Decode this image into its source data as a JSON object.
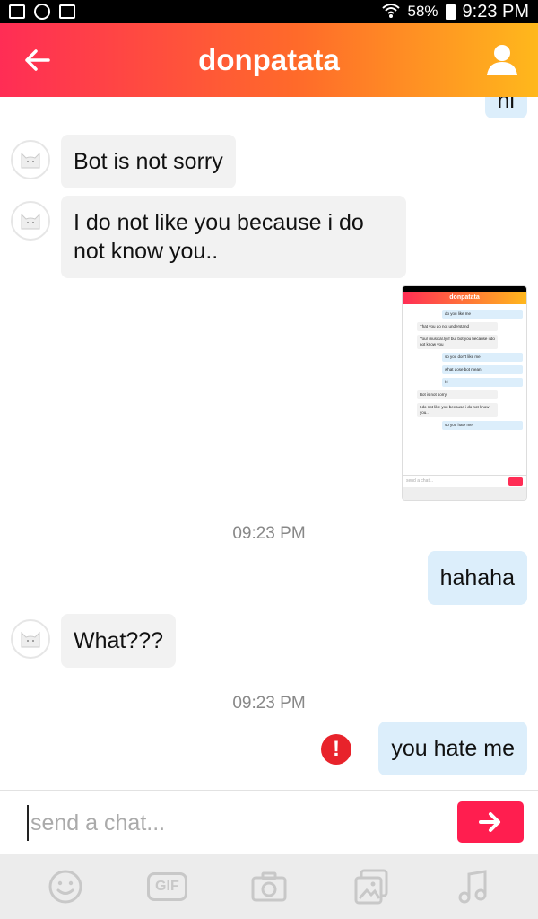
{
  "status_bar": {
    "battery": "58%",
    "time": "9:23 PM"
  },
  "header": {
    "title": "donpatata"
  },
  "messages": {
    "partial_out": "hi",
    "msg1": "Bot is not sorry",
    "msg2_line1": "I do not like you because i do",
    "msg2_line2": "not know you..",
    "time1": "09:23 PM",
    "msg3": "hahaha",
    "msg4": "What???",
    "time2": "09:23 PM",
    "msg5": "you hate me"
  },
  "thumbnail": {
    "title": "donpatata",
    "lines": [
      "do you like me",
      "That you do not understand",
      "Your musical.ly if but bot you because i do not know you",
      "so you don't like me",
      "what dose bot mean",
      "hi",
      "Bot is not sorry",
      "I do not like you because i do not know you..",
      "so you hate me"
    ],
    "placeholder": "send a chat..."
  },
  "composer": {
    "placeholder": "send a chat..."
  },
  "toolbar": {
    "gif_label": "GIF"
  },
  "colors": {
    "accent": "#ff1e4f",
    "bubble_out": "#dceefb",
    "bubble_in": "#f2f2f2",
    "error": "#e8232b"
  },
  "icons": [
    "back-arrow-icon",
    "profile-icon",
    "emoji-icon",
    "gif-icon",
    "camera-icon",
    "gallery-icon",
    "music-note-icon",
    "send-arrow-icon",
    "error-icon"
  ]
}
